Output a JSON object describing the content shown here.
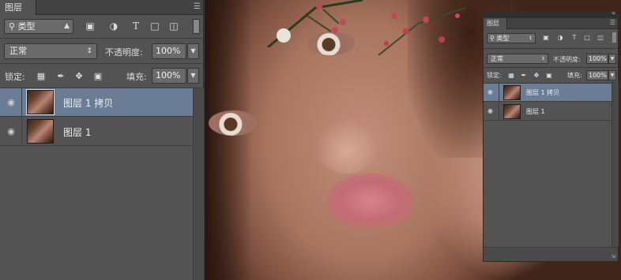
{
  "main_panel": {
    "tab_title": "图层",
    "tab_menu_icon": "panel-menu-icon",
    "filter": {
      "label": "类型",
      "search_icon": "search-icon"
    },
    "filter_icons": [
      "image-filter-icon",
      "adjustment-filter-icon",
      "text-filter-icon",
      "shape-filter-icon",
      "smart-object-filter-icon"
    ],
    "blend_mode": "正常",
    "opacity_label": "不透明度:",
    "opacity_value": "100%",
    "lock_label": "锁定:",
    "lock_icons": [
      "lock-transparency-icon",
      "lock-pixels-icon",
      "lock-position-icon",
      "lock-all-icon"
    ],
    "fill_label": "填充:",
    "fill_value": "100%",
    "layers": [
      {
        "name": "图层 1 拷贝",
        "selected": true,
        "visible": true
      },
      {
        "name": "图层 1",
        "selected": false,
        "visible": true
      }
    ]
  },
  "mini_panel": {
    "tab_title": "图层",
    "filter": {
      "label": "类型"
    },
    "blend_mode": "正常",
    "opacity_label": "不透明度:",
    "opacity_value": "100%",
    "lock_label": "锁定:",
    "fill_label": "填充:",
    "fill_value": "100%",
    "layers": [
      {
        "name": "图层 1 拷贝",
        "selected": true
      },
      {
        "name": "图层 1",
        "selected": false
      }
    ]
  },
  "colors": {
    "panel_bg": "#535353",
    "selected_layer": "#6a7d95",
    "input_bg": "#6a6a6a"
  }
}
